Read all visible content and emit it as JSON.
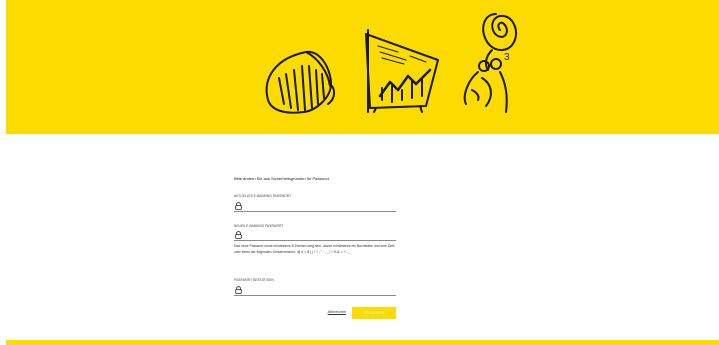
{
  "banner": {
    "color": "#fcdb00",
    "superscript": "3"
  },
  "form": {
    "intro": "Bitte ändern Sie aus Sicherheitsgründen Ihr Passwort.",
    "current_password": {
      "label": "AKTUELLES E-BANKING PASSWORT",
      "value": "",
      "icon": "lock-icon"
    },
    "new_password": {
      "label": "NEUES E-BANKING PASSWORT",
      "value": "",
      "icon": "lock-icon"
    },
    "hint": "Das neue Passwort muss mindestens 8 Zeichen lang sein, davon mindestens ein Buchstabe und eine Zahl oder eines der folgenden Sonderzeichen: @ # = $ ( ) ! ? ; ° . , _ / \\ % & = + - _",
    "confirm_password": {
      "label": "PASSWORT BESTÄTIGEN",
      "value": "",
      "icon": "lock-icon"
    },
    "cancel_label": "Abbrechen",
    "submit_label": "SPEICHERN"
  },
  "colors": {
    "accent": "#fcdb00",
    "input_border": "#8a8a8a"
  }
}
